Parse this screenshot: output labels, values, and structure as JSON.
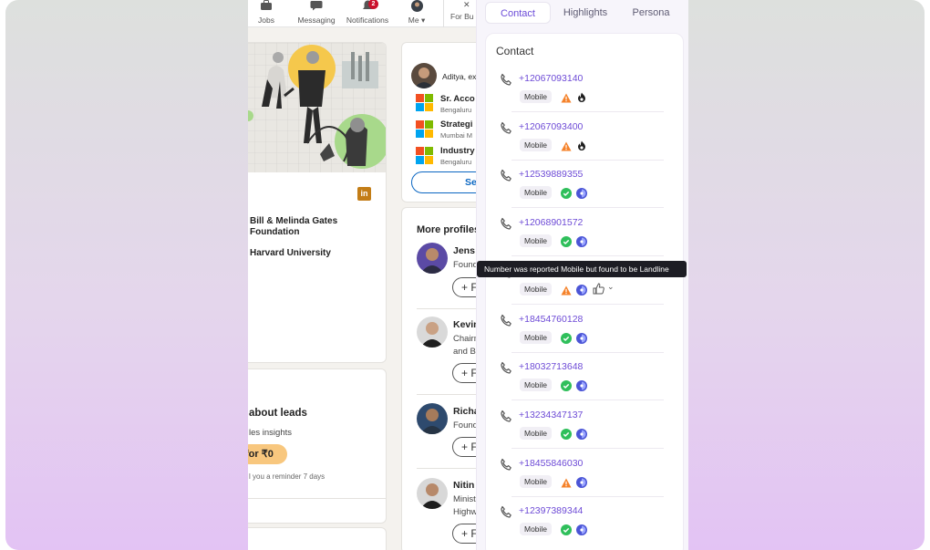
{
  "linkedin": {
    "nav": {
      "jobs": "Jobs",
      "messaging": "Messaging",
      "notifications": "Notifications",
      "notifications_count": "2",
      "me": "Me",
      "for_business": "For Bu"
    },
    "profile": {
      "education": [
        "Bill & Melinda Gates Foundation",
        "Harvard University"
      ]
    },
    "premium": {
      "title": "about leads",
      "subtitle": "les insights",
      "cta": "for ₹0",
      "note": "l you a reminder 7 days"
    },
    "right": {
      "viewer_name": "Aditya, ex",
      "companies": [
        {
          "name": "Sr. Acco",
          "location": "Bengaluru"
        },
        {
          "name": "Strategi",
          "location": "Mumbai M"
        },
        {
          "name": "Industry",
          "location": "Bengaluru"
        }
      ],
      "see_label": "Se",
      "more_profiles_title": "More profiles",
      "people": [
        {
          "name": "Jens",
          "desc": [
            "Found"
          ],
          "button": "+ F"
        },
        {
          "name": "Kevin",
          "desc": [
            "Chairm",
            "and B"
          ],
          "button": "+ F"
        },
        {
          "name": "Richa",
          "desc": [
            "Found"
          ],
          "button": "+ F"
        },
        {
          "name": "Nitin",
          "desc": [
            "Minist",
            "Highw"
          ],
          "button": "+ F"
        }
      ]
    }
  },
  "panel": {
    "tabs": [
      "Contact",
      "Highlights",
      "Persona"
    ],
    "active_tab": "Contact",
    "section_title": "Contact",
    "tooltip": "Number was reported Mobile but found to be Landline",
    "contacts": [
      {
        "number": "+12067093140",
        "type": "Mobile",
        "status": "warning",
        "source": "flame"
      },
      {
        "number": "+12067093400",
        "type": "Mobile",
        "status": "warning",
        "source": "flame"
      },
      {
        "number": "+12539889355",
        "type": "Mobile",
        "status": "verified",
        "source": "globe"
      },
      {
        "number": "+12068901572",
        "type": "Mobile",
        "status": "verified",
        "source": "globe"
      },
      {
        "number": "",
        "type": "Mobile",
        "status": "warning",
        "source": "globe"
      },
      {
        "number": "+18454760128",
        "type": "Mobile",
        "status": "verified",
        "source": "globe"
      },
      {
        "number": "+18032713648",
        "type": "Mobile",
        "status": "verified",
        "source": "globe"
      },
      {
        "number": "+13234347137",
        "type": "Mobile",
        "status": "verified",
        "source": "globe"
      },
      {
        "number": "+18455846030",
        "type": "Mobile",
        "status": "warning",
        "source": "globe"
      },
      {
        "number": "+12397389344",
        "type": "Mobile",
        "status": "verified",
        "source": "globe"
      }
    ],
    "colors": {
      "accent": "#6d4ad6",
      "warning": "#f5822a",
      "verified": "#2fbf5b",
      "source": "#4b55d6"
    }
  }
}
